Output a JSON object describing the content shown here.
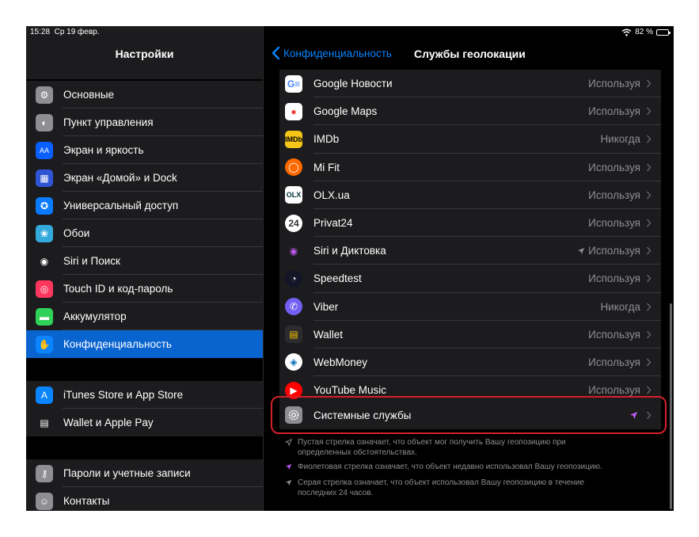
{
  "status": {
    "time": "15:28",
    "date": "Ср 19 февр.",
    "battery": "82 %",
    "battery_level": 0.82
  },
  "left": {
    "title": "Настройки",
    "group1": [
      {
        "label": "Основные",
        "icon": "gear-icon",
        "color": "#8e8e93"
      },
      {
        "label": "Пункт управления",
        "icon": "toggles-icon",
        "color": "#8e8e93"
      },
      {
        "label": "Экран и яркость",
        "icon": "text-size-icon",
        "color": "#0a60ff"
      },
      {
        "label": "Экран «Домой» и Dock",
        "icon": "grid-icon",
        "color": "#2f55d4"
      },
      {
        "label": "Универсальный доступ",
        "icon": "accessibility-icon",
        "color": "#0a7aff"
      },
      {
        "label": "Обои",
        "icon": "flower-icon",
        "color": "#34aadc"
      },
      {
        "label": "Siri и Поиск",
        "icon": "siri-icon",
        "color": "#1c1c1e"
      },
      {
        "label": "Touch ID и код-пароль",
        "icon": "fingerprint-icon",
        "color": "#ff375f"
      },
      {
        "label": "Аккумулятор",
        "icon": "battery-icon",
        "color": "#30d158"
      },
      {
        "label": "Конфиденциальность",
        "icon": "hand-icon",
        "color": "#0a64d0",
        "active": true
      }
    ],
    "group2": [
      {
        "label": "iTunes Store и App Store",
        "icon": "app-store-icon",
        "color": "#0a84ff"
      },
      {
        "label": "Wallet и Apple Pay",
        "icon": "wallet-icon",
        "color": "#1c1c1e"
      }
    ],
    "group3": [
      {
        "label": "Пароли и учетные записи",
        "icon": "key-icon",
        "color": "#8e8e93"
      },
      {
        "label": "Контакты",
        "icon": "contacts-icon",
        "color": "#8e8e93"
      }
    ]
  },
  "right": {
    "back_label": "Конфиденциальность",
    "title": "Службы геолокации",
    "apps": [
      {
        "name": "Google Новости",
        "value": "Используя",
        "icon": "google-news-icon",
        "color": "#ffffff",
        "glyph": "G≡",
        "fg": "#4285f4"
      },
      {
        "name": "Google Maps",
        "value": "Используя",
        "icon": "google-maps-icon",
        "color": "#ffffff",
        "glyph": "●",
        "fg": "#ea4335"
      },
      {
        "name": "IMDb",
        "value": "Никогда",
        "icon": "imdb-icon",
        "color": "#f5c518",
        "glyph": "IMDb",
        "fg": "#000000"
      },
      {
        "name": "Mi Fit",
        "value": "Используя",
        "icon": "mi-fit-icon",
        "color": "#ff6a00",
        "glyph": "◯",
        "fg": "#ffffff"
      },
      {
        "name": "OLX.ua",
        "value": "Используя",
        "icon": "olx-icon",
        "color": "#ffffff",
        "glyph": "OLX",
        "fg": "#002f34"
      },
      {
        "name": "Privat24",
        "value": "Используя",
        "icon": "privat24-icon",
        "color": "#ffffff",
        "glyph": "24",
        "fg": "#333333"
      },
      {
        "name": "Siri и Диктовка",
        "value": "Используя",
        "icon": "siri-icon",
        "color": "#1c1c1e",
        "glyph": "◉",
        "fg": "#bf5af2",
        "arrow": "gray"
      },
      {
        "name": "Speedtest",
        "value": "Используя",
        "icon": "speedtest-icon",
        "color": "#141526",
        "glyph": "◔",
        "fg": "#ffffff"
      },
      {
        "name": "Viber",
        "value": "Никогда",
        "icon": "viber-icon",
        "color": "#7360f2",
        "glyph": "✆",
        "fg": "#ffffff"
      },
      {
        "name": "Wallet",
        "value": "Используя",
        "icon": "wallet-icon",
        "color": "#2c2c2e",
        "glyph": "▤",
        "fg": "#ffcc00"
      },
      {
        "name": "WebMoney",
        "value": "Используя",
        "icon": "webmoney-icon",
        "color": "#ffffff",
        "glyph": "◈",
        "fg": "#036cb5"
      },
      {
        "name": "YouTube Music",
        "value": "Используя",
        "icon": "youtube-music-icon",
        "color": "#ff0000",
        "glyph": "▶",
        "fg": "#ffffff"
      }
    ],
    "system": {
      "name": "Системные службы",
      "icon": "gear-icon",
      "arrow_color": "#bf5af2"
    },
    "notes": [
      {
        "text": "Пустая стрелка означает, что объект мог получить Вашу геопозицию при определенных обстоятельствах.",
        "arrow": "hollow"
      },
      {
        "text": "Фиолетовая стрелка означает, что объект недавно использовал Вашу геопозицию.",
        "arrow": "purple"
      },
      {
        "text": "Серая стрелка означает, что объект использовал Вашу геопозицию в течение последних 24 часов.",
        "arrow": "gray"
      }
    ]
  },
  "colors": {
    "accent": "#0a84ff",
    "highlight": "#d4202a",
    "active": "#0a64d0"
  }
}
